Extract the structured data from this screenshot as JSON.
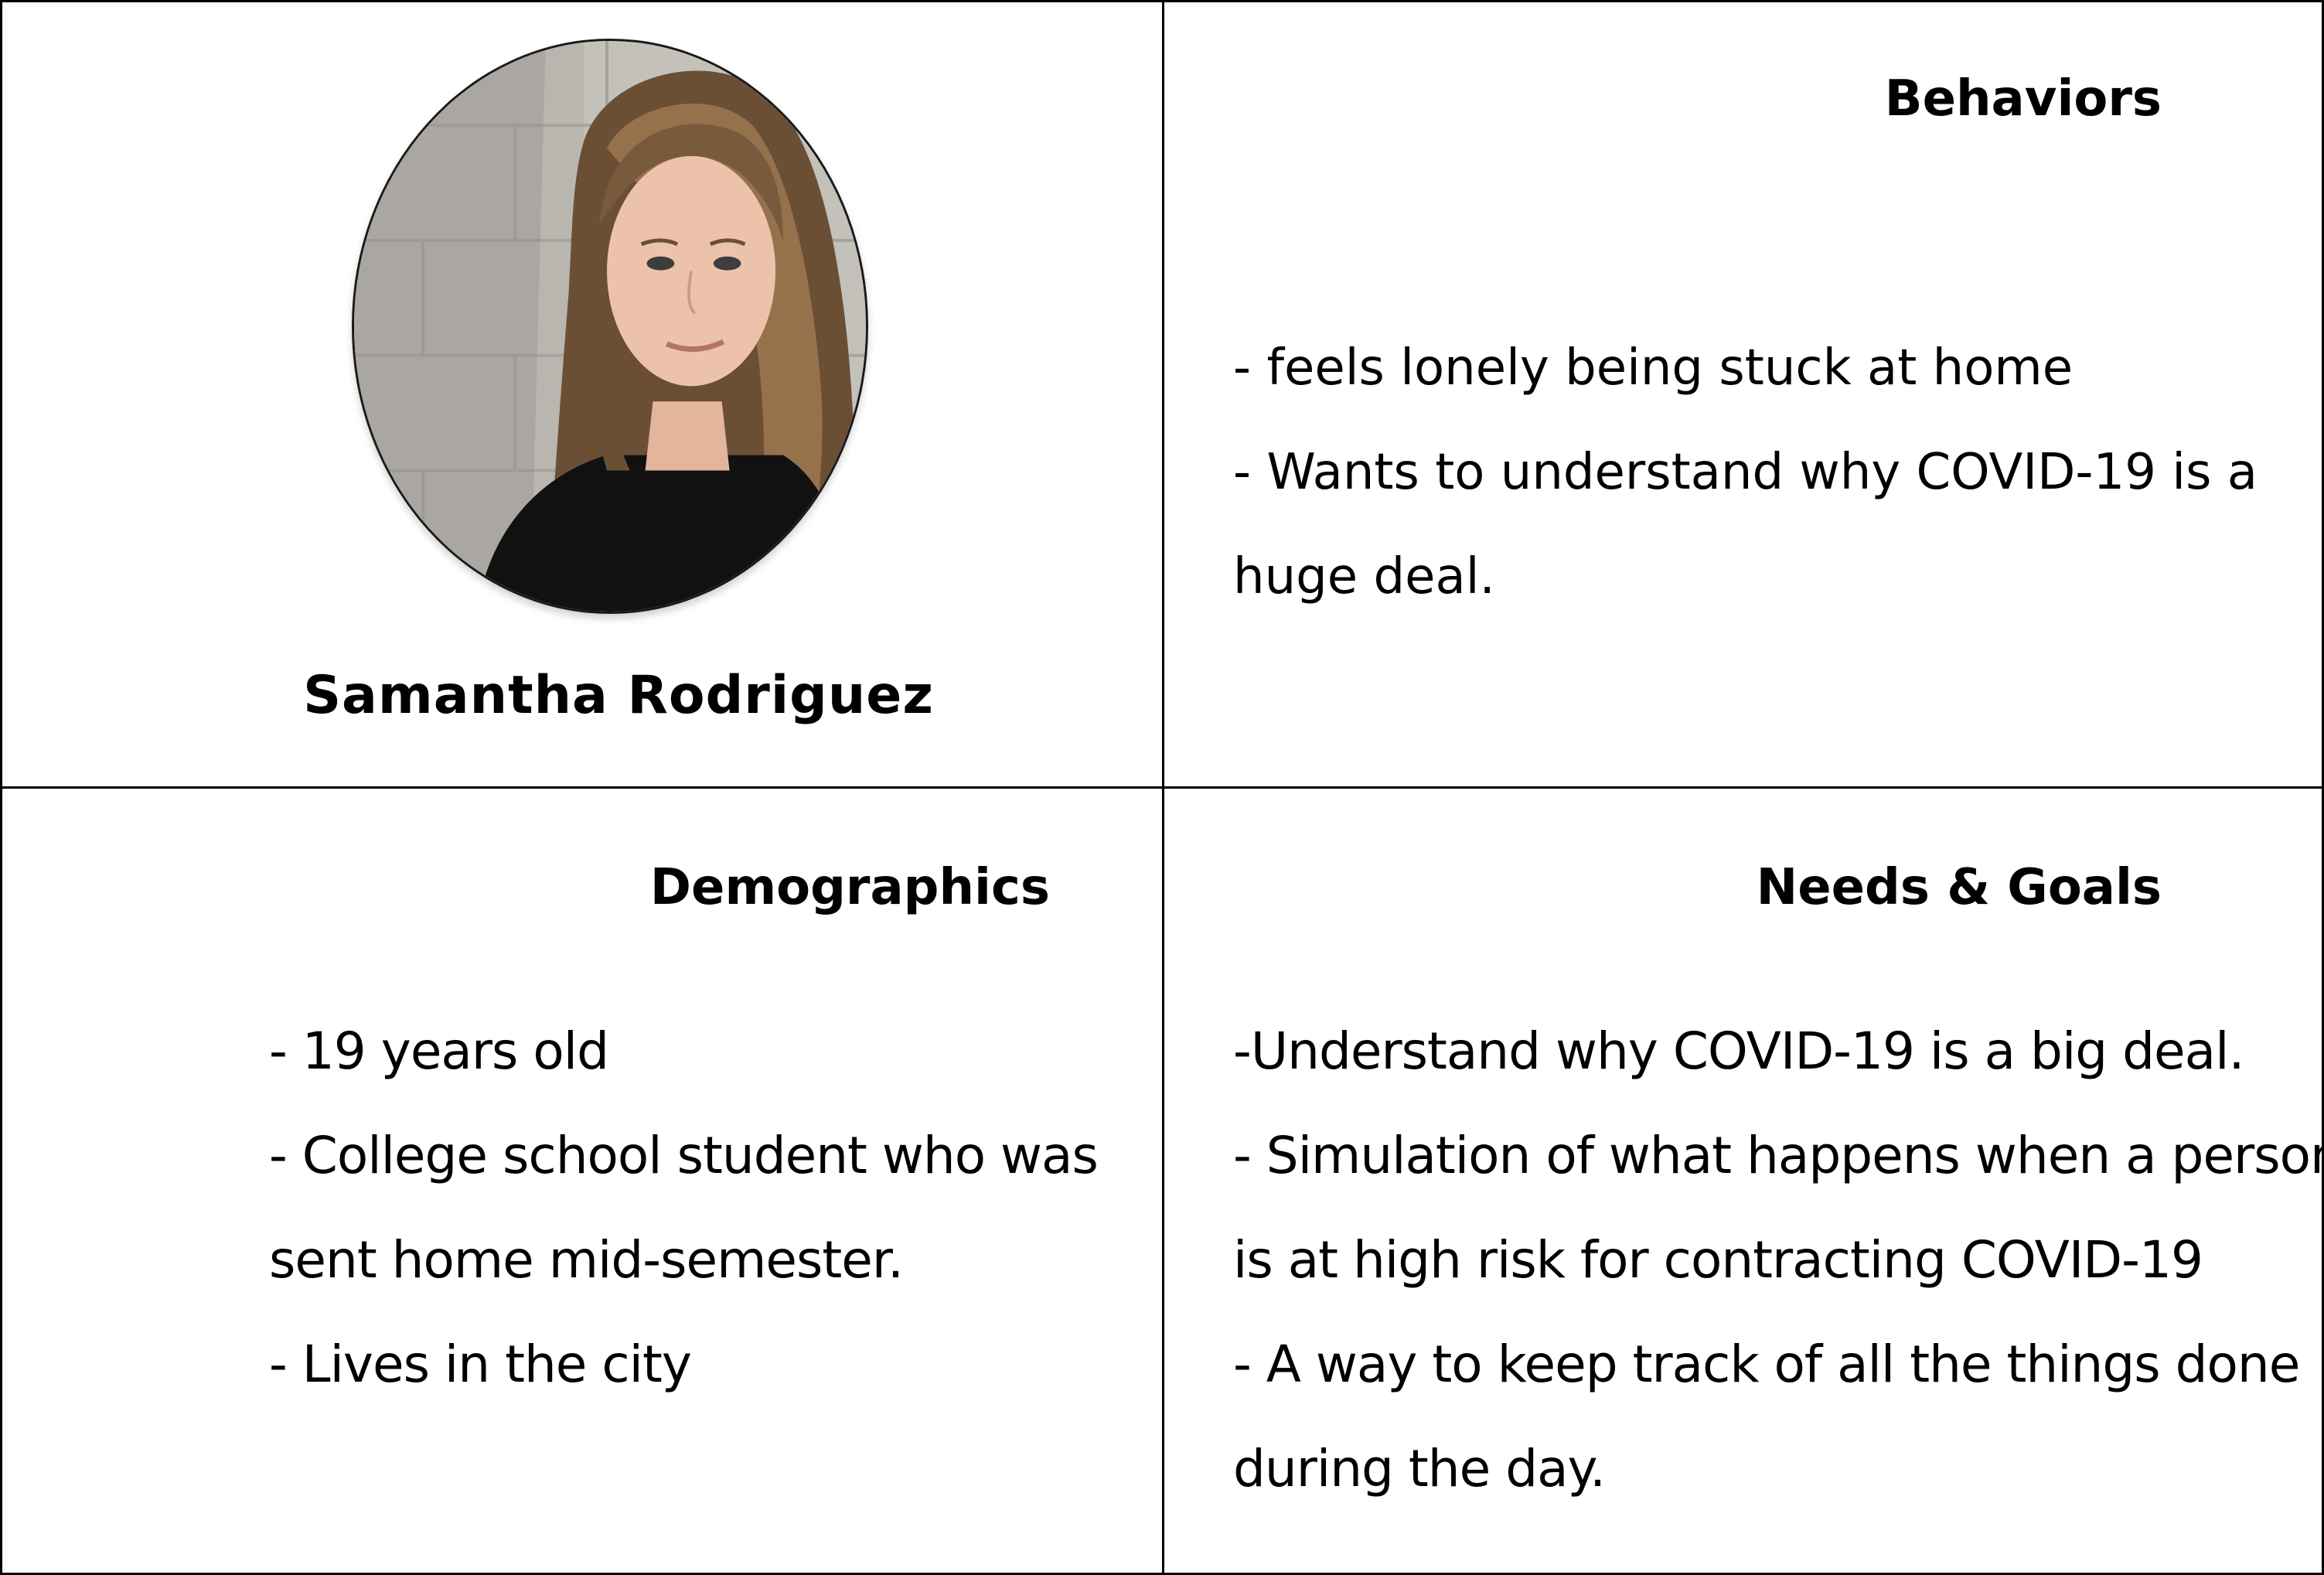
{
  "persona": {
    "name": "Samantha Rodriguez",
    "photo": {
      "subject": "young woman with long light-brown hair, black top, leaning on a grey block wall"
    }
  },
  "sections": {
    "behaviors": {
      "heading": "Behaviors",
      "lines": [
        "- feels lonely being stuck at home",
        "- Wants to understand why COVID-19 is a",
        "huge deal."
      ]
    },
    "demographics": {
      "heading": "Demographics",
      "lines": [
        "- 19 years old",
        "- College school student who was",
        "sent home mid-semester.",
        "- Lives in the city"
      ]
    },
    "needs_goals": {
      "heading": "Needs & Goals",
      "lines": [
        "-Understand why COVID-19 is a big deal.",
        "- Simulation of what happens when a person",
        "is at high risk for contracting COVID-19",
        "- A way to keep track of all the things done",
        "during the day."
      ]
    }
  },
  "colors": {
    "grid_lines": "#000000",
    "text": "#000000",
    "background": "#ffffff"
  }
}
